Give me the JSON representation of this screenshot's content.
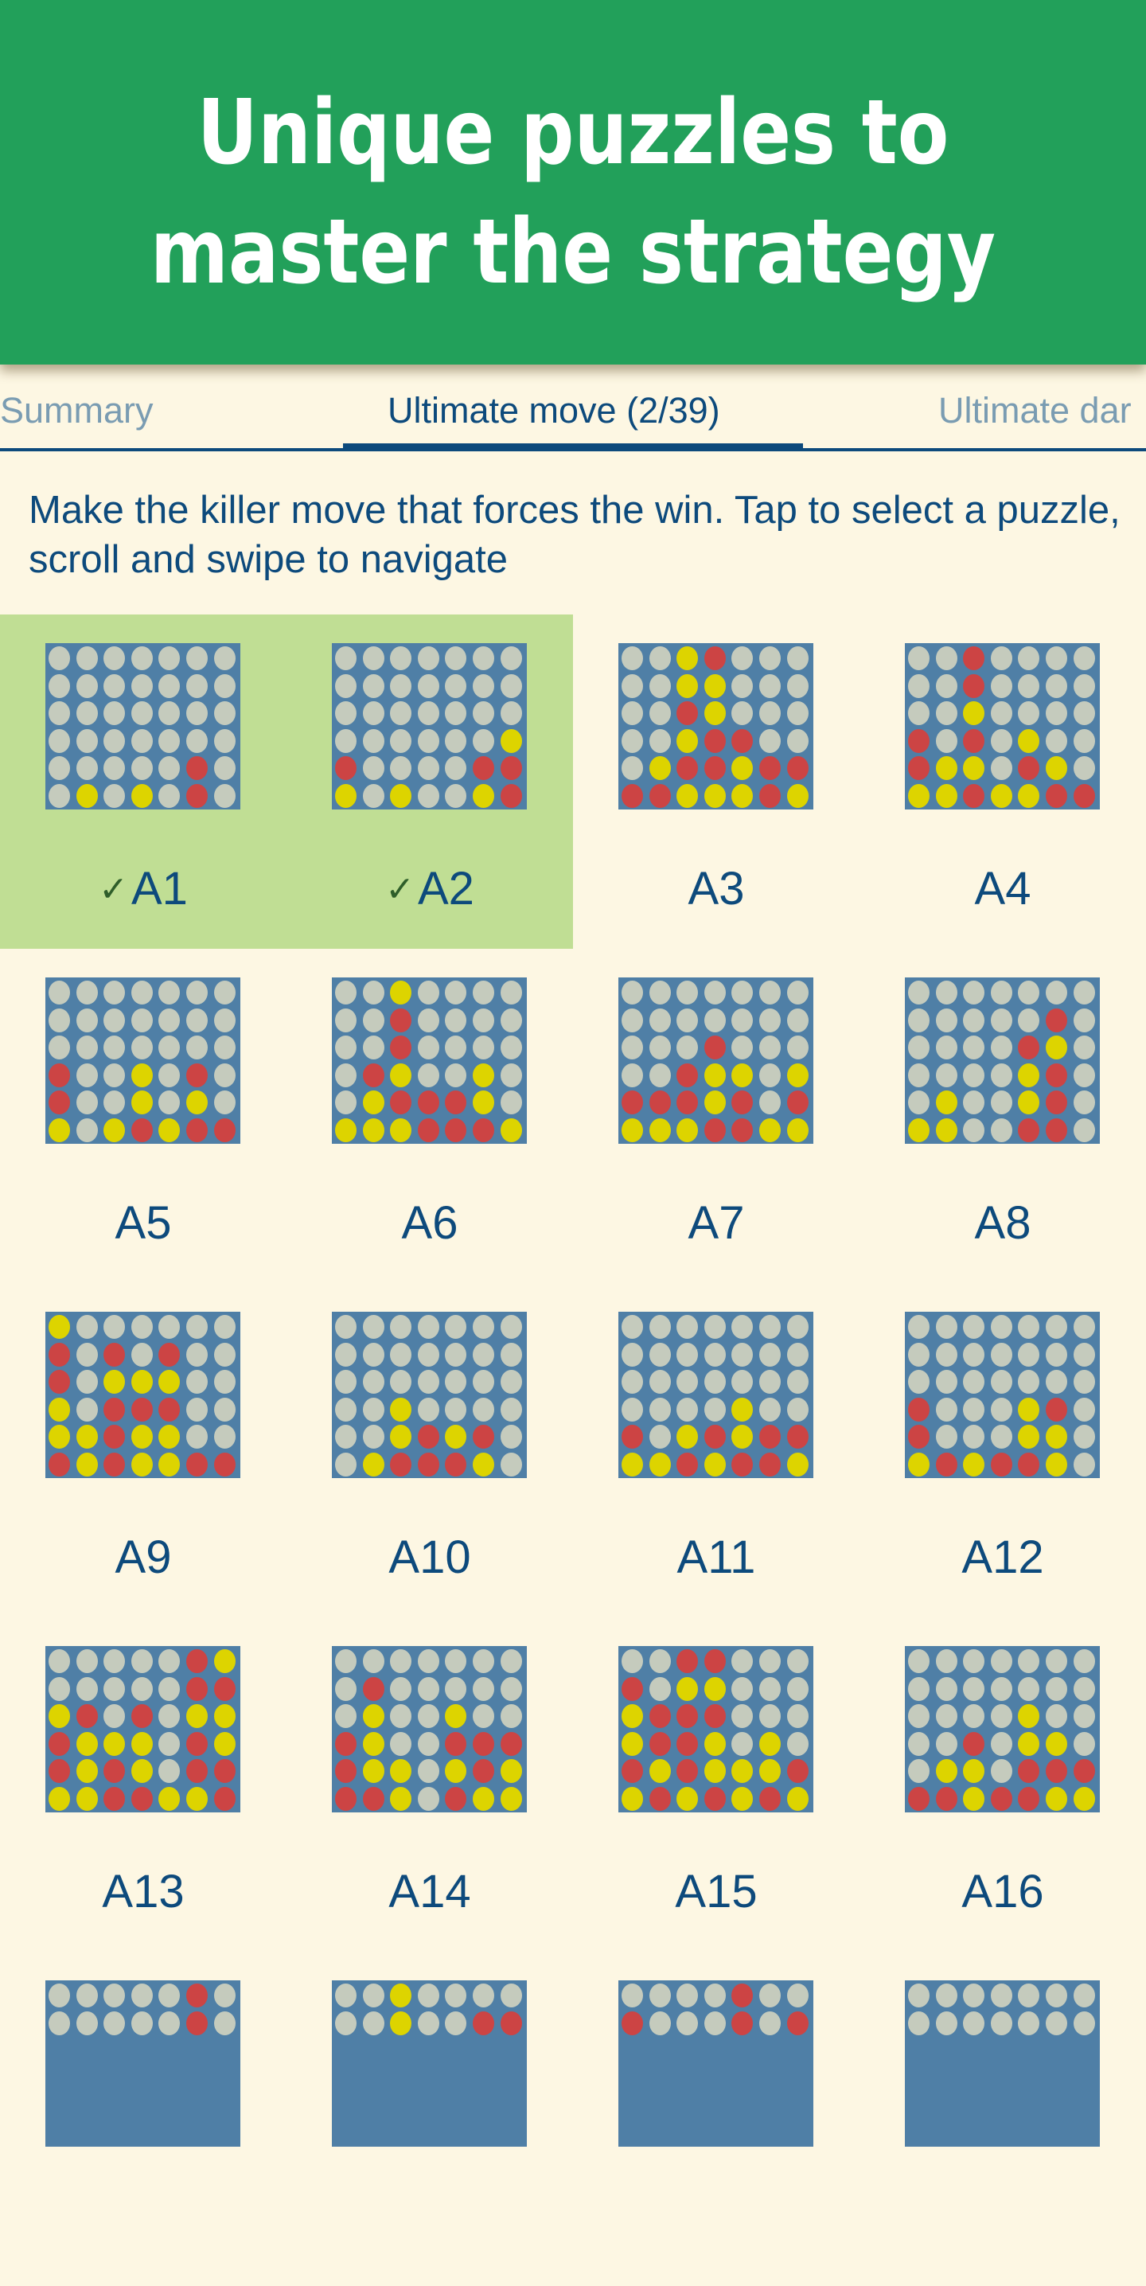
{
  "header": {
    "title_line1": "Unique puzzles to",
    "title_line2": "master the strategy"
  },
  "tabs": [
    {
      "label": "Summary",
      "active": false
    },
    {
      "label": "Ultimate move (2/39)",
      "active": true
    },
    {
      "label": "Ultimate dar",
      "active": false
    }
  ],
  "description": "Make the killer move that forces the win. Tap to select a puzzle, scroll and swipe to navigate",
  "colors": {
    "header": "#22a05a",
    "background": "#fdf7e3",
    "solved": "#c0de94",
    "board": "#4f7fa6",
    "empty": "#c5cbbd",
    "red": "#cc4444",
    "yellow": "#ddd400",
    "text": "#0d4a7c"
  },
  "check_icon": "✓",
  "puzzles": [
    {
      "label": "A1",
      "solved": true,
      "board": [
        ".......",
        ".......",
        ".......",
        ".......",
        ".....R.",
        ".Y.Y.R."
      ]
    },
    {
      "label": "A2",
      "solved": true,
      "board": [
        ".......",
        ".......",
        ".......",
        "......Y",
        "R....RR",
        "Y.Y..YR"
      ]
    },
    {
      "label": "A3",
      "solved": false,
      "board": [
        "..YR...",
        "..YY...",
        "..RY...",
        "..YRR..",
        ".YRRYRR",
        "RRYYYRY"
      ]
    },
    {
      "label": "A4",
      "solved": false,
      "board": [
        "..R....",
        "..R....",
        "..Y....",
        "R.R.Y..",
        "RYY.RY.",
        "YYRYYRR"
      ]
    },
    {
      "label": "A5",
      "solved": false,
      "board": [
        ".......",
        ".......",
        ".......",
        "R..Y.R.",
        "R..Y.Y.",
        "Y.YRYRR"
      ]
    },
    {
      "label": "A6",
      "solved": false,
      "board": [
        "..Y....",
        "..R....",
        "..R....",
        ".RY..Y.",
        ".YRRRY.",
        "YYYRRRY"
      ]
    },
    {
      "label": "A7",
      "solved": false,
      "board": [
        ".......",
        ".......",
        "...R...",
        "..RYY.Y",
        "RRRYR.R",
        "YYYRRYY"
      ]
    },
    {
      "label": "A8",
      "solved": false,
      "board": [
        ".......",
        ".....R.",
        "....RY.",
        "....YR.",
        ".Y..YR.",
        "YY..RR."
      ]
    },
    {
      "label": "A9",
      "solved": false,
      "board": [
        "Y......",
        "R.R.R..",
        "R.YYY..",
        "Y.RRR..",
        "YYRYY..",
        "RYRYYRR"
      ]
    },
    {
      "label": "A10",
      "solved": false,
      "board": [
        ".......",
        ".......",
        ".......",
        "..Y....",
        "..YRYR.",
        ".YRRRY."
      ]
    },
    {
      "label": "A11",
      "solved": false,
      "board": [
        ".......",
        ".......",
        ".......",
        "....Y..",
        "R.YRYRR",
        "YYRYRRY"
      ]
    },
    {
      "label": "A12",
      "solved": false,
      "board": [
        ".......",
        ".......",
        ".......",
        "R...YR.",
        "R...YY.",
        "YRYRRY."
      ]
    },
    {
      "label": "A13",
      "solved": false,
      "board": [
        ".....RY",
        ".....RR",
        "YR.R.YY",
        "RYYY.RY",
        "RYRY.RR",
        "YYRRYYR"
      ]
    },
    {
      "label": "A14",
      "solved": false,
      "board": [
        ".......",
        ".R.....",
        ".Y..Y..",
        "RY..RRR",
        "RYY.YRY",
        "RRY.RYY"
      ]
    },
    {
      "label": "A15",
      "solved": false,
      "board": [
        "..RR...",
        "R.YY...",
        "YRRR...",
        "YRRY.Y.",
        "RYRYYYR",
        "YRYRYRY"
      ]
    },
    {
      "label": "A16",
      "solved": false,
      "board": [
        ".......",
        ".......",
        "....Y..",
        "..R.YY.",
        ".YY.RRR",
        "RRYRRYY"
      ]
    },
    {
      "board": [
        ".....R.",
        ".....R."
      ]
    },
    {
      "board": [
        "..Y....",
        "..Y..RR"
      ]
    },
    {
      "board": [
        "....R..",
        "R...R.R"
      ]
    },
    {
      "board": [
        ".......",
        "......."
      ]
    }
  ]
}
